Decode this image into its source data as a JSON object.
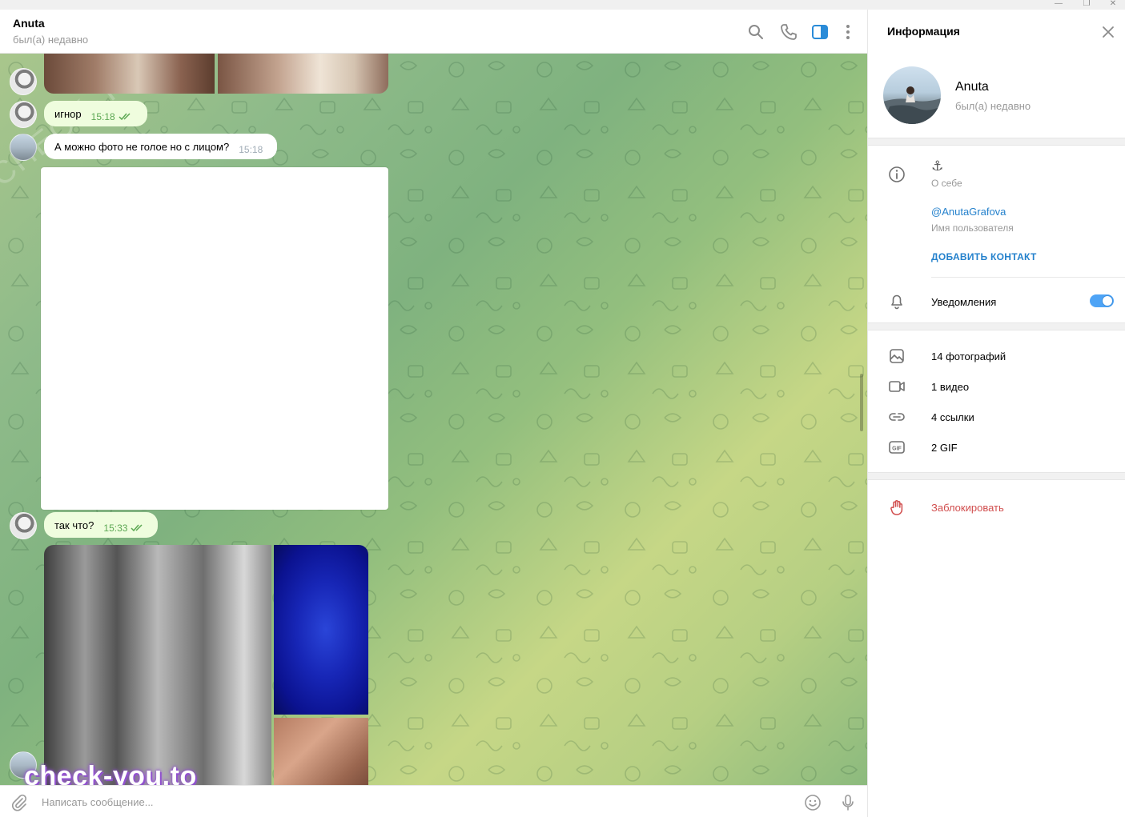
{
  "header": {
    "peer_name": "Anuta",
    "peer_status": "был(а) недавно"
  },
  "messages": [
    {
      "direction": "out",
      "text": "игнор",
      "time": "15:18",
      "read": true
    },
    {
      "direction": "in",
      "text": "А можно фото не голое но с лицом?",
      "time": "15:18"
    },
    {
      "direction": "out",
      "text": "так что?",
      "time": "15:33",
      "read": true
    }
  ],
  "composer": {
    "placeholder": "Написать сообщение..."
  },
  "watermark": {
    "bottom": "check-you.to",
    "diagonal": "CHECK-YOU.ME"
  },
  "panel": {
    "title": "Информация",
    "name": "Anuta",
    "status": "был(а) недавно",
    "bio_value": "⚓",
    "bio_label": "О себе",
    "username": "@AnutaGrafova",
    "username_label": "Имя пользователя",
    "add_contact": "ДОБАВИТЬ КОНТАКТ",
    "notifications_label": "Уведомления",
    "notifications_on": true,
    "media": [
      {
        "icon": "photo-icon",
        "label": "14 фотографий"
      },
      {
        "icon": "video-icon",
        "label": "1 видео"
      },
      {
        "icon": "link-icon",
        "label": "4 ссылки"
      },
      {
        "icon": "gif-icon",
        "label": "2 GIF"
      }
    ],
    "block_label": "Заблокировать"
  },
  "colors": {
    "accent": "#2481cc",
    "outgoing_bubble": "#effdde",
    "read_check": "#5ca853",
    "danger": "#d14e4e",
    "toggle_on": "#4ea4f6"
  }
}
